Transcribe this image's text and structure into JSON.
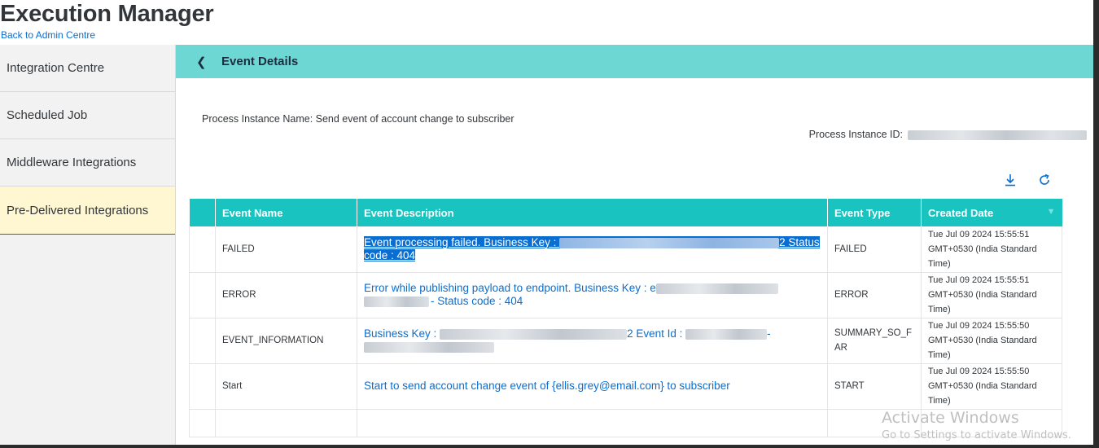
{
  "header": {
    "title": "Execution Manager",
    "back_link": "Back to Admin Centre"
  },
  "sidebar": {
    "items": [
      {
        "label": "Integration Centre"
      },
      {
        "label": "Scheduled Job"
      },
      {
        "label": "Middleware Integrations"
      },
      {
        "label": "Pre-Delivered Integrations",
        "active": true
      }
    ]
  },
  "details": {
    "title": "Event Details",
    "process_instance_name": "Process Instance Name: Send event of account change to subscriber",
    "process_instance_id_label": "Process Instance ID:"
  },
  "toolbar": {
    "download_icon": "download-icon",
    "refresh_icon": "refresh-icon"
  },
  "table": {
    "columns": [
      "Event Name",
      "Event Description",
      "Event Type",
      "Created Date"
    ],
    "rows": [
      {
        "name": "FAILED",
        "desc_prefix": "Event processing failed. Business Key :",
        "desc_suffix": "2 Status code : 404",
        "type": "FAILED",
        "date": "Tue Jul 09 2024 15:55:51 GMT+0530 (India Standard Time)"
      },
      {
        "name": "ERROR",
        "desc_prefix": "Error while publishing payload to endpoint. Business Key : e",
        "desc_suffix": "- Status code : 404",
        "type": "ERROR",
        "date": "Tue Jul 09 2024 15:55:51 GMT+0530 (India Standard Time)"
      },
      {
        "name": "EVENT_INFORMATION",
        "desc_prefix": "Business Key :",
        "desc_middle": "2 Event Id :",
        "desc_suffix": "-",
        "type": "SUMMARY_SO_FAR",
        "date": "Tue Jul 09 2024 15:55:50 GMT+0530 (India Standard Time)"
      },
      {
        "name": "Start",
        "description": "Start to send account change event of {ellis.grey@email.com} to subscriber",
        "type": "START",
        "date": "Tue Jul 09 2024 15:55:50 GMT+0530 (India Standard Time)"
      }
    ]
  },
  "watermark": {
    "line1": "Activate Windows",
    "line2": "Go to Settings to activate Windows."
  },
  "colors": {
    "header_bar": "#6dd7d4",
    "table_header": "#19c3c0",
    "link": "#0a6ed1",
    "active_sidebar": "#fef7d1"
  }
}
